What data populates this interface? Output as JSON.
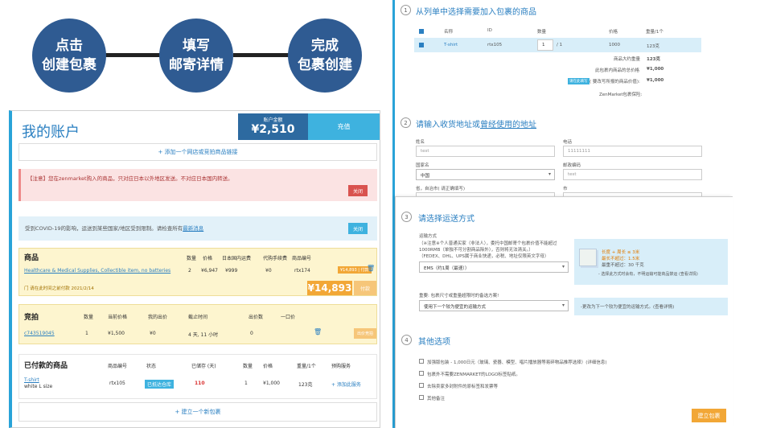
{
  "steps": [
    {
      "line1": "点击",
      "line2": "创建包裹"
    },
    {
      "line1": "填写",
      "line2": "邮寄详情"
    },
    {
      "line1": "完成",
      "line2": "包裹创建"
    }
  ],
  "account": {
    "title": "我的账户",
    "balance_label": "账户金额",
    "balance_value": "¥2,510",
    "recharge_label": "充值",
    "add_link": "+ 添加一个网店或竞拍商品链接",
    "notice": "【注意】您在zenmarket购入的商品，只对应日本以外地区发送。不对应日本国内转送。",
    "notice_close": "关闭",
    "covid_text": "受到COVID-19的影响，运送到某些国家/地区受到限制。请检查所有",
    "covid_link": "最新消息",
    "covid_close": "关闭",
    "goods": {
      "title": "商品",
      "headers": [
        "数量",
        "价格",
        "日本国内运费",
        "代购手续费",
        "商品编号"
      ],
      "item_name": "Healthcare & Medical Supplies, Collectible item, no batteries",
      "qty": "2",
      "price": "¥6,947",
      "shipping": "¥999",
      "fee": "¥0",
      "code": "rtx174",
      "item_pay": "¥14,893 | 付款",
      "deadline": "门 请在此时间之前付款 2021/2/14",
      "total": "¥14,893",
      "pay_label": "付款"
    },
    "auction": {
      "title": "竞拍",
      "headers": [
        "数量",
        "当前价格",
        "我的出价",
        "截止时间",
        "出价数",
        "一口价"
      ],
      "item_code": "c743519045",
      "qty": "1",
      "current": "¥1,500",
      "mybid": "¥0",
      "time_left": "4 天, 11 小时",
      "bids": "0",
      "bid_btn": "出价竞拍"
    },
    "paid": {
      "title": "已付款的商品",
      "headers": [
        "商品编号",
        "状态",
        "已储存 (天)",
        "数量",
        "价格",
        "重量/1个",
        "预购服务"
      ],
      "item_name": "T-shirt",
      "item_sub": "white L size",
      "code": "rtx105",
      "status": "已抵达仓库",
      "days": "110",
      "qty": "1",
      "price": "¥1,000",
      "weight": "123克",
      "service": "+ 添加此服务"
    },
    "new_package": "+ 建立一个新包裹"
  },
  "section1": {
    "num": "1",
    "title": "从列单中选择需要加入包裹的商品",
    "headers": [
      "名称",
      "ID",
      "数量",
      "价格",
      "重量/1个"
    ],
    "row": {
      "name": "T-shirt",
      "id": "rtx105",
      "qty": "1",
      "qty_max": "/ 1",
      "price": "1000",
      "weight": "123克"
    },
    "sum1_label": "商品大约重量",
    "sum1_val": "123克",
    "sum2_label": "此包裹内商品的总价格",
    "sum2_val": "¥1,000",
    "sum3_tag": "请在此填写",
    "sum3_label": "( 要改写所报的商品价值):",
    "sum3_val": "¥1,000",
    "insurance": "ZenMarket包裹保险:"
  },
  "section2": {
    "num": "2",
    "title_a": "请输入收货地址或",
    "title_b": "曾经使用的地址",
    "name_label": "姓名",
    "name_value": "test",
    "phone_label": "电话",
    "phone_value": "11111111",
    "country_label": "国家名",
    "country_value": "中国",
    "zip_label": "邮政编码",
    "zip_value": "test",
    "province_label": "省，自治市( 请正确填写)",
    "city_label": "市"
  },
  "section3": {
    "num": "3",
    "title": "请选择运送方式",
    "method_label": "运输方式",
    "note": [
      "（※注意※个人普通买家（非法人），委托中国邮寄个包裹价值不能超过",
      "1000RMB（单独不可分割商品除外），否则将无法清关。）",
      "（FEDEX、DHL、UPS属于商业快递，必税、地址仅限英文字母）"
    ],
    "method_value": "EMS（约1周（最速））",
    "info1": [
      "长度 + 周长 ≤ 3米",
      "最长不超过：1.5米",
      "最重不超过：30 千克",
      "- 选择此方式时会有，不明运输可能商品禁运 (查看详情)"
    ],
    "important": "重要: 包裹尺寸或重量超限时的备选方案!",
    "backup_value": "使用下一个较为便宜的运输方式",
    "info2": "-更改为下一个较为便宜的运输方式。(查看详情)"
  },
  "section4": {
    "num": "4",
    "title": "其他选项",
    "options": [
      "加强版包装 - 1,000日元（玻璃、瓷器、模型、唱片播放器等易碎物品推荐选择）(详细信息)",
      "包裹外不需要ZENMARKET的LOGO标签贴纸。",
      "去除卖家多封附件的原标签和发票等",
      "其他备注"
    ],
    "create_btn": "建立包裹"
  }
}
